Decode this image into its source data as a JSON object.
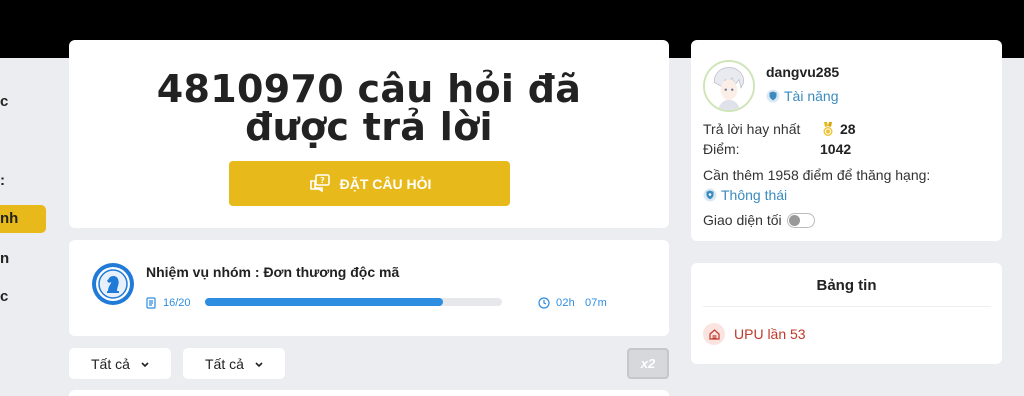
{
  "sidebar": {
    "items": [
      {
        "label": "c",
        "active": false
      },
      {
        "label": ":",
        "active": false
      },
      {
        "label": "nh",
        "active": true
      },
      {
        "label": "n",
        "active": false
      },
      {
        "label": "c",
        "active": false
      }
    ]
  },
  "hero": {
    "title_line1": "4810970 câu hỏi đã",
    "title_line2": "được trả lời",
    "ask_button_label": "ĐẶT CÂU HỎI",
    "accent_color": "#e8b91a"
  },
  "mission": {
    "badge_icon": "chess-knight-icon",
    "title": "Nhiệm vụ nhóm : Đơn thương độc mã",
    "progress_text": "16/20",
    "progress_fraction": 0.8,
    "time_hours": "02h",
    "time_minutes": "07m",
    "progress_color": "#2d8de0"
  },
  "filters": {
    "filter1_label": "Tất cả",
    "filter2_label": "Tất cả",
    "multiplier_label": "x2"
  },
  "profile": {
    "username": "dangvu285",
    "rank": "Tài năng",
    "best_answers_label": "Trả lời hay nhất",
    "best_answers_value": "28",
    "points_label": "Điểm:",
    "points_value": "1042",
    "need_points_text": "Cần thêm 1958 điểm để thăng hạng:",
    "next_rank": "Thông thái",
    "dark_mode_label": "Giao diện tối",
    "rank_color": "#3b8bbf"
  },
  "news": {
    "title": "Bảng tin",
    "items": [
      {
        "label": "UPU lần 53"
      }
    ],
    "item_color": "#c0392b"
  }
}
